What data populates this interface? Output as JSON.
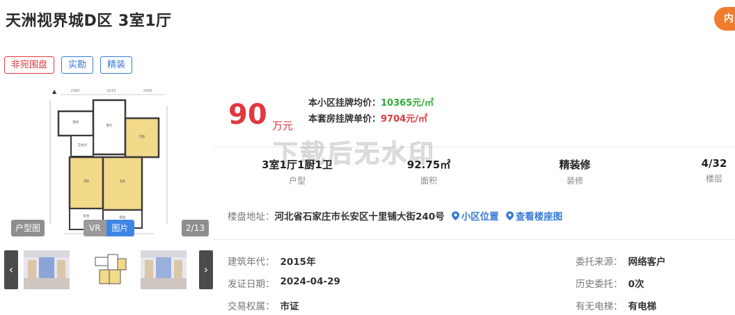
{
  "header": {
    "title": "天洲视界城D区 3室1厅",
    "corner_button": "内"
  },
  "tags": [
    {
      "label": "非宛围盘",
      "color": "#e0383e"
    },
    {
      "label": "实勘",
      "color": "#3a7bd5"
    },
    {
      "label": "精装",
      "color": "#3a7bd5"
    }
  ],
  "gallery": {
    "kind_label": "户型图",
    "switch": {
      "vr": "VR",
      "photo": "图片"
    },
    "counter": "2/13"
  },
  "price": {
    "total": "90",
    "unit": "万元",
    "community_avg_label": "本小区挂牌均价：",
    "community_avg_value": "10365元/㎡",
    "listing_unit_label": "本套房挂牌单价：",
    "listing_unit_value": "9704元/㎡"
  },
  "watermark": "下载后无水印",
  "specs": [
    {
      "value": "3室1厅1厨1卫",
      "label": "户型"
    },
    {
      "value": "92.75㎡",
      "label": "面积"
    },
    {
      "value": "精装修",
      "label": "装修"
    },
    {
      "value": "4/32",
      "label": "楼层"
    }
  ],
  "address": {
    "label": "楼盘地址：",
    "value": "河北省石家庄市长安区十里铺大街240号",
    "location_link": "小区位置",
    "building_link": "查看楼座图"
  },
  "info_left": [
    {
      "label": "建筑年代：",
      "value": "2015年"
    },
    {
      "label": "发证日期：",
      "value": "2024-04-29"
    },
    {
      "label": "交易权属：",
      "value": "市证"
    }
  ],
  "info_right": [
    {
      "label": "委托来源：",
      "value": "网络客户"
    },
    {
      "label": "历史委托：",
      "value": "0次"
    },
    {
      "label": "有无电梯：",
      "value": "有电梯"
    }
  ],
  "icons": {
    "prev": "chevron-left-icon",
    "next": "chevron-right-icon",
    "pin": "location-pin-icon"
  },
  "colors": {
    "price_red": "#e0383e",
    "link_blue": "#3a7bd5",
    "avg_green": "#2fa836",
    "accent_orange": "#f07d2e"
  }
}
